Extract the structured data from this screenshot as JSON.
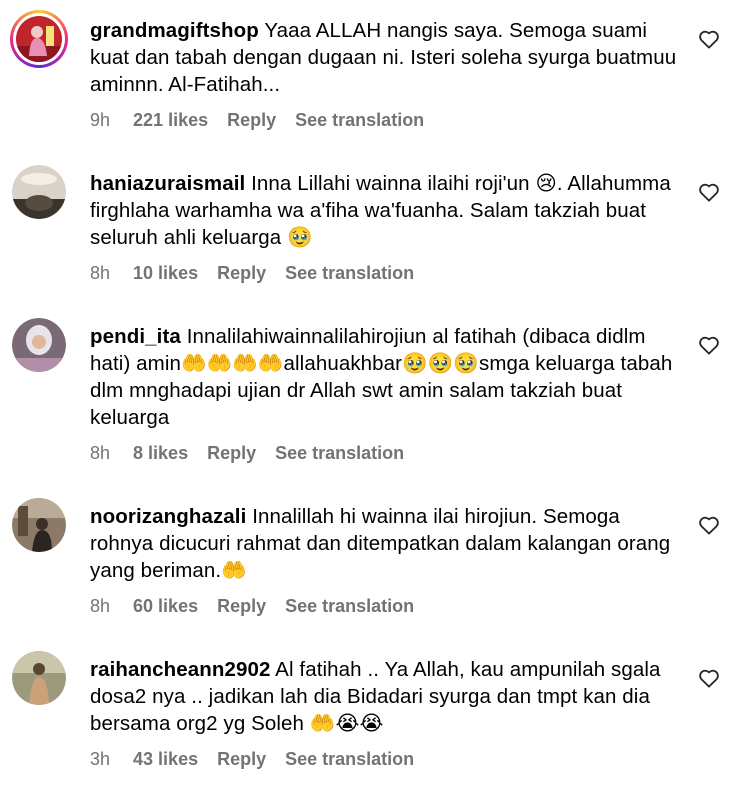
{
  "comments": [
    {
      "username": "grandmagiftshop",
      "text": "Yaaa ALLAH nangis saya. Semoga suami kuat dan tabah dengan dugaan ni. Isteri soleha syurga buatmuu aminnn. Al-Fatihah...",
      "time": "9h",
      "likes": "221 likes",
      "reply": "Reply",
      "translate": "See translation",
      "avatar_icon": "profile-photo-icon",
      "has_story_ring": true
    },
    {
      "username": "haniazuraismail",
      "text": "Inna Lillahi wainna ilaihi roji'un 😢. Allahumma firghlaha warhamha wa a'fiha wa'fuanha. Salam takziah buat seluruh ahli keluarga 🥹",
      "time": "8h",
      "likes": "10 likes",
      "reply": "Reply",
      "translate": "See translation",
      "avatar_icon": "profile-photo-icon",
      "has_story_ring": false
    },
    {
      "username": "pendi_ita",
      "text": "Innalilahiwainnalilahirojiun al fatihah (dibaca didlm hati) amin🤲🤲🤲🤲allahuakhbar🥹🥹🥹smga keluarga tabah dlm mnghadapi ujian dr Allah swt amin salam takziah buat keluarga",
      "time": "8h",
      "likes": "8 likes",
      "reply": "Reply",
      "translate": "See translation",
      "avatar_icon": "profile-photo-icon",
      "has_story_ring": false
    },
    {
      "username": "noorizanghazali",
      "text": "Innalillah hi wainna ilai hirojiun. Semoga rohnya dicucuri rahmat dan ditempatkan dalam kalangan orang yang beriman.🤲",
      "time": "8h",
      "likes": "60 likes",
      "reply": "Reply",
      "translate": "See translation",
      "avatar_icon": "profile-photo-icon",
      "has_story_ring": false
    },
    {
      "username": "raihancheann2902",
      "text": "Al fatihah .. Ya Allah, kau ampunilah sgala dosa2 nya .. jadikan lah dia Bidadari syurga dan tmpt kan dia bersama org2 yg Soleh 🤲😭😭",
      "time": "3h",
      "likes": "43 likes",
      "reply": "Reply",
      "translate": "See translation",
      "avatar_icon": "profile-photo-icon",
      "has_story_ring": false
    }
  ],
  "like_icon": "heart-outline-icon",
  "colors": {
    "text": "#000000",
    "meta": "#737373",
    "background": "#ffffff"
  }
}
